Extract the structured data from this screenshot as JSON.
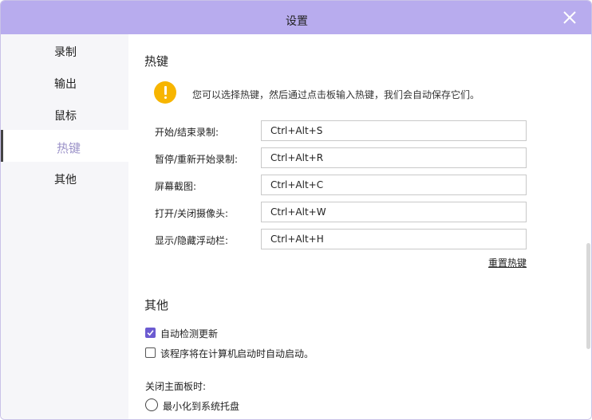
{
  "window": {
    "title": "设置"
  },
  "sidebar": {
    "items": [
      {
        "label": "录制"
      },
      {
        "label": "输出"
      },
      {
        "label": "鼠标"
      },
      {
        "label": "热键",
        "active": true
      },
      {
        "label": "其他"
      }
    ]
  },
  "hotkeys": {
    "section_title": "热键",
    "notice": "您可以选择热键，然后通过点击板输入热键，我们会自动保存它们。",
    "rows": [
      {
        "label": "开始/结束录制:",
        "value": "Ctrl+Alt+S"
      },
      {
        "label": "暂停/重新开始录制:",
        "value": "Ctrl+Alt+R"
      },
      {
        "label": "屏幕截图:",
        "value": "Ctrl+Alt+C"
      },
      {
        "label": "打开/关闭摄像头:",
        "value": "Ctrl+Alt+W"
      },
      {
        "label": "显示/隐藏浮动栏:",
        "value": "Ctrl+Alt+H"
      }
    ],
    "reset_label": "重置热键"
  },
  "other": {
    "section_title": "其他",
    "auto_update": {
      "label": "自动检测更新",
      "checked": true
    },
    "auto_start": {
      "label": "该程序将在计算机启动时自动启动。",
      "checked": false
    },
    "close_panel_label": "关闭主面板时:",
    "minimize_option": {
      "label": "最小化到系统托盘",
      "selected": false
    }
  },
  "colors": {
    "titlebar": "#b8acee",
    "accent": "#6c5bd1",
    "active_nav_text": "#9b92c8",
    "notice_icon": "#f7b500"
  },
  "icons": {
    "close": "close-icon",
    "notice": "warning-icon",
    "check": "check-icon"
  }
}
